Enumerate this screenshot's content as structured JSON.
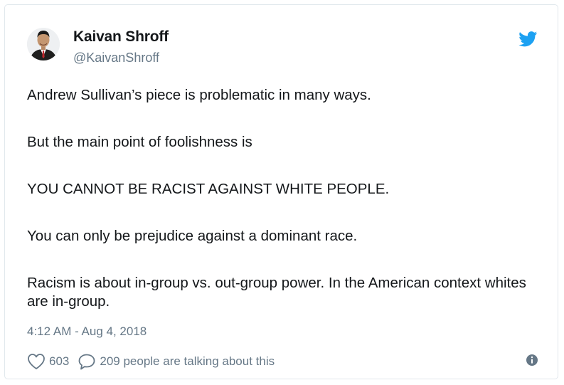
{
  "author": {
    "name": "Kaivan Shroff",
    "handle": "@KaivanShroff",
    "avatar_icon": "profile-photo"
  },
  "platform": {
    "icon": "twitter-bird-icon",
    "brand_color": "#1da1f2"
  },
  "tweet": {
    "paragraphs": [
      "Andrew Sullivan’s piece is problematic in many ways.",
      "But the main point of foolishness is",
      "YOU CANNOT BE RACIST AGAINST WHITE PEOPLE.",
      "You can only be prejudice against a dominant race.",
      "Racism is about in-group vs. out-group power. In the American context whites are in-group."
    ],
    "timestamp": "4:12 AM - Aug 4, 2018"
  },
  "actions": {
    "likes": "603",
    "talking": "209 people are talking about this",
    "like_icon": "heart-icon",
    "reply_icon": "speech-bubble-icon",
    "info_icon": "info-icon"
  },
  "colors": {
    "text": "#14171a",
    "secondary": "#657786",
    "border": "#e1e8ed"
  }
}
